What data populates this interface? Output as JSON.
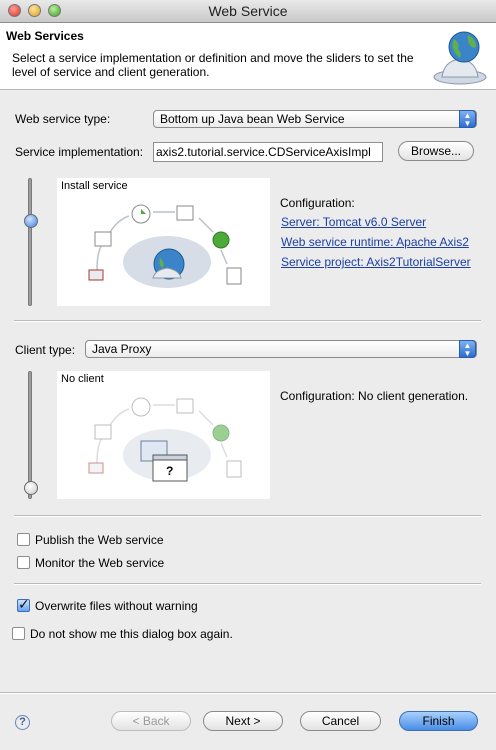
{
  "window": {
    "title": "Web Service"
  },
  "banner": {
    "heading": "Web Services",
    "description": "Select a service implementation or definition and move the sliders to set the level of service and client generation."
  },
  "service": {
    "type_label": "Web service type:",
    "type_value": "Bottom up Java bean Web Service",
    "impl_label": "Service implementation:",
    "impl_value": "axis2.tutorial.service.CDServiceAxisImpl",
    "browse_label": "Browse...",
    "panel_title": "Install service",
    "config_label": "Configuration:",
    "links": {
      "server": "Server: Tomcat v6.0 Server",
      "runtime": "Web service runtime: Apache Axis2",
      "project": "Service project: Axis2TutorialServer"
    }
  },
  "client": {
    "type_label": "Client type:",
    "type_value": "Java Proxy",
    "panel_title": "No client",
    "config_text": "Configuration: No client generation."
  },
  "options": {
    "publish": {
      "label": "Publish the Web service",
      "checked": false
    },
    "monitor": {
      "label": "Monitor the Web service",
      "checked": false
    },
    "overwrite": {
      "label": "Overwrite files without warning",
      "checked": true
    },
    "dont_show": {
      "label": "Do not show me this dialog box again.",
      "checked": false
    }
  },
  "footer": {
    "help": "?",
    "back": "< Back",
    "next": "Next >",
    "cancel": "Cancel",
    "finish": "Finish"
  },
  "colors": {
    "link": "#1b3fa5",
    "accent": "#4a8ee6"
  }
}
